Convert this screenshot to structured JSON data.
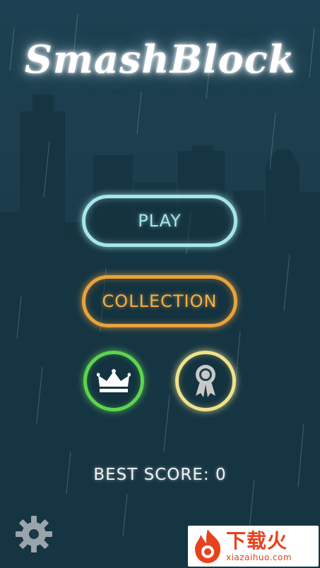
{
  "app": {
    "title": "SmashBlock"
  },
  "menu": {
    "play_label": "PLAY",
    "collection_label": "COLLECTION",
    "leaderboard_icon": "crown-icon",
    "achievements_icon": "award-ribbon-icon"
  },
  "score": {
    "best_score_text": "BEST SCORE: 0"
  },
  "settings": {
    "icon": "gear-icon"
  },
  "watermark": {
    "chinese_text": "下载火",
    "url_text": "xiazaihuo.com"
  },
  "colors": {
    "play": "#a6e6ea",
    "collection": "#e9a23d",
    "leaderboard": "#5ed44f",
    "achievements": "#efe28a",
    "background": "#1b3d4b",
    "watermark_brand": "#e8411e"
  }
}
